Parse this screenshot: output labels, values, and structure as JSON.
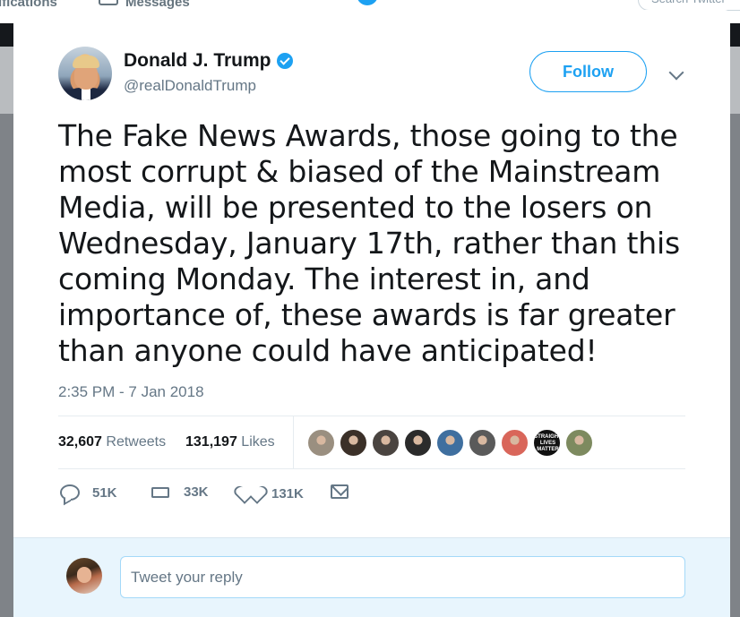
{
  "background": {
    "nav_notifications": "ifications",
    "nav_messages": "Messages",
    "search_placeholder": "Search Twitter"
  },
  "author": {
    "name": "Donald J. Trump",
    "handle": "@realDonaldTrump",
    "verified": true
  },
  "follow_label": "Follow",
  "tweet": {
    "lines": [
      "The Fake News Awards, those going to the",
      "most corrupt & biased of the Mainstream",
      "Media, will be presented to the losers on",
      "Wednesday, January 17th, rather than this",
      "coming Monday. The interest in, and",
      "importance of, these awards is far greater",
      "than anyone could have anticipated!"
    ],
    "timestamp": "2:35 PM - 7 Jan 2018"
  },
  "stats": {
    "retweets_count": "32,607",
    "retweets_label": "Retweets",
    "likes_count": "131,197",
    "likes_label": "Likes",
    "liker_avatar_colors": [
      "#9a8f80",
      "#3b3028",
      "#4a4440",
      "#2b2b2b",
      "#3f6f9f",
      "#5a5a5a",
      "#d9665a",
      "#111111",
      "#7d8a5f"
    ],
    "blm_avatar_text": "STRAIGHT LIVES MATTER"
  },
  "actions": {
    "reply_count": "51K",
    "retweet_count": "33K",
    "like_count": "131K"
  },
  "reply": {
    "placeholder": "Tweet your reply"
  },
  "colors": {
    "accent": "#1da1f2",
    "text": "#14171a",
    "muted": "#657786"
  }
}
